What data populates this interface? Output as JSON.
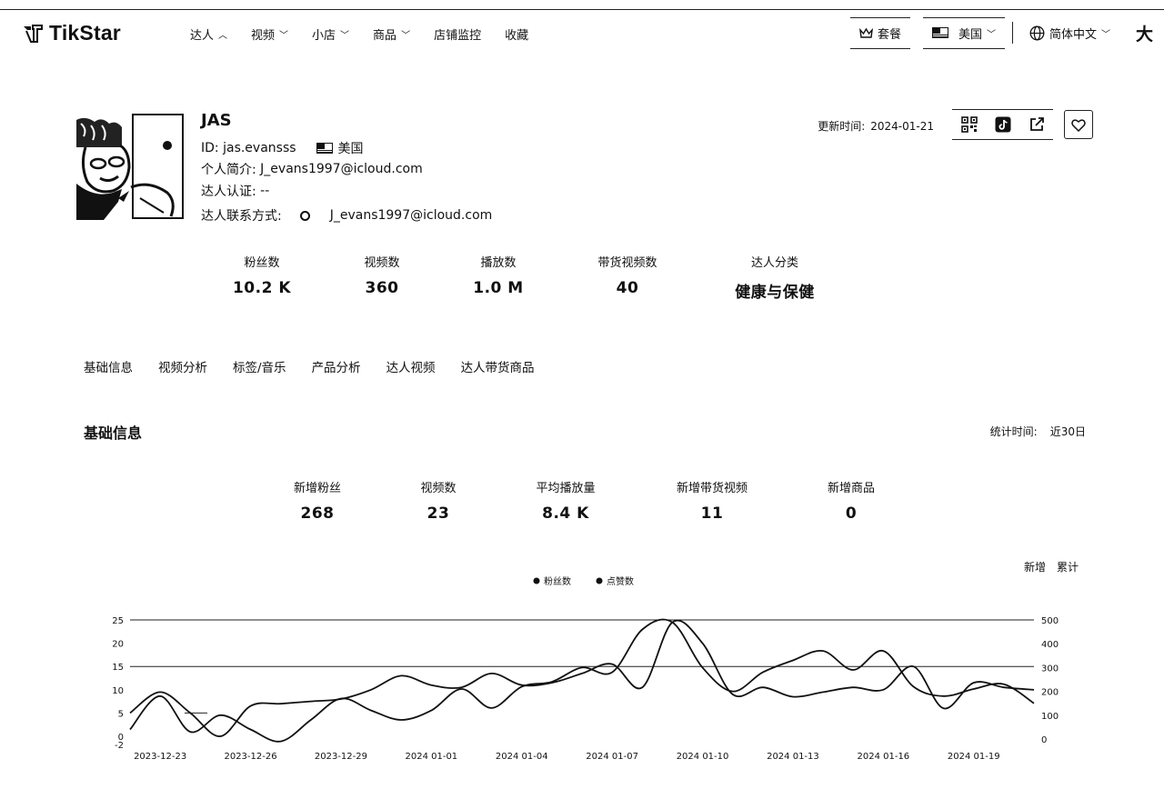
{
  "nav": {
    "logo": "TikStar",
    "menu": [
      {
        "label": "达人",
        "chevron": "up"
      },
      {
        "label": "视频",
        "chevron": "down"
      },
      {
        "label": "小店",
        "chevron": "down"
      },
      {
        "label": "商品",
        "chevron": "down"
      },
      {
        "label": "店铺监控",
        "chevron": ""
      },
      {
        "label": "收藏",
        "chevron": ""
      }
    ],
    "plan": "套餐",
    "region": "美国",
    "language": "简体中文",
    "font_size": "大"
  },
  "profile": {
    "name": "JAS",
    "id_label": "ID:",
    "id": "jas.evansss",
    "country": "美国",
    "bio_label": "个人简介:",
    "bio": "J_evans1997@icloud.com",
    "verify_label": "达人认证:",
    "verify": "--",
    "contact_label": "达人联系方式:",
    "contact": "J_evans1997@icloud.com",
    "update_label": "更新时间:",
    "update_date": "2024-01-21"
  },
  "stats": [
    {
      "label": "粉丝数",
      "value": "10.2 K"
    },
    {
      "label": "视频数",
      "value": "360"
    },
    {
      "label": "播放数",
      "value": "1.0 M"
    },
    {
      "label": "带货视频数",
      "value": "40"
    },
    {
      "label": "达人分类",
      "value": "健康与保健"
    }
  ],
  "tabs": [
    "基础信息",
    "视频分析",
    "标签/音乐",
    "产品分析",
    "达人视频",
    "达人带货商品"
  ],
  "section": {
    "title": "基础信息",
    "time_label": "统计时间:",
    "time_value": "近30日"
  },
  "stats2": [
    {
      "label": "新增粉丝",
      "value": "268"
    },
    {
      "label": "视频数",
      "value": "23"
    },
    {
      "label": "平均播放量",
      "value": "8.4 K"
    },
    {
      "label": "新增带货视频",
      "value": "11"
    },
    {
      "label": "新增商品",
      "value": "0"
    }
  ],
  "toggle": {
    "new": "新增",
    "total": "累计"
  },
  "chart_data": {
    "type": "line",
    "legend_position": "top-center",
    "x": [
      "2023-12-22",
      "2023-12-23",
      "2023-12-24",
      "2023-12-25",
      "2023-12-26",
      "2023-12-27",
      "2023-12-28",
      "2023-12-29",
      "2023-12-30",
      "2023-12-31",
      "2024-01-01",
      "2024-01-02",
      "2024-01-03",
      "2024-01-04",
      "2024-01-05",
      "2024-01-06",
      "2024-01-07",
      "2024-01-08",
      "2024-01-09",
      "2024-01-10",
      "2024-01-11",
      "2024-01-12",
      "2024-01-13",
      "2024-01-14",
      "2024-01-15",
      "2024-01-16",
      "2024-01-17",
      "2024-01-18",
      "2024-01-19",
      "2024-01-20",
      "2024-01-21"
    ],
    "x_tick_labels": [
      "2023-12-23",
      "2023-12-26",
      "2023-12-29",
      "2024 01-01",
      "2024 01-04",
      "2024 01-07",
      "2024 01-10",
      "2024 01-13",
      "2024 01-16",
      "2024 01-19"
    ],
    "y_left": {
      "ticks": [
        "25",
        "20",
        "15",
        "10",
        "5",
        "0",
        "-2"
      ],
      "range": [
        -2,
        25
      ]
    },
    "y_right": {
      "ticks": [
        "500",
        "400",
        "300",
        "200",
        "100",
        "0"
      ],
      "range": [
        0,
        500
      ]
    },
    "grid": "horizontal",
    "series": [
      {
        "name": "粉丝数",
        "axis": "left",
        "values": [
          5,
          9.5,
          5,
          0,
          6.5,
          7,
          7.5,
          8,
          10,
          13,
          11,
          10.5,
          13.5,
          11,
          11.5,
          13.5,
          15.5,
          10.5,
          24.5,
          20,
          9,
          10.5,
          8.5,
          9.5,
          10.5,
          10,
          15,
          6,
          11.5,
          10.5,
          10
        ]
      },
      {
        "name": "点赞数",
        "axis": "right",
        "values": [
          40,
          180,
          30,
          100,
          40,
          -10,
          80,
          170,
          120,
          80,
          120,
          210,
          130,
          220,
          240,
          300,
          280,
          460,
          490,
          300,
          200,
          280,
          330,
          370,
          290,
          370,
          220,
          180,
          210,
          230,
          150
        ]
      }
    ]
  }
}
